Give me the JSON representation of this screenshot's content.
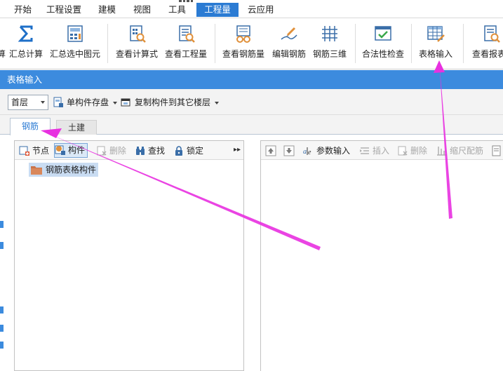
{
  "menu": {
    "items": [
      "开始",
      "工程设置",
      "建模",
      "视图",
      "工具",
      "工程量",
      "云应用"
    ],
    "active_index": 5
  },
  "ribbon": {
    "partial_left_label": "算",
    "buttons": [
      {
        "label": "汇总计算",
        "icon": "sigma-icon"
      },
      {
        "label": "汇总选中图元",
        "icon": "calc-selected-icon"
      },
      {
        "label": "查看计算式",
        "icon": "view-formula-icon"
      },
      {
        "label": "查看工程量",
        "icon": "view-quantity-icon"
      },
      {
        "label": "查看钢筋量",
        "icon": "view-rebar-icon"
      },
      {
        "label": "编辑钢筋",
        "icon": "edit-rebar-icon"
      },
      {
        "label": "钢筋三维",
        "icon": "rebar-3d-icon"
      },
      {
        "label": "合法性检查",
        "icon": "check-icon"
      },
      {
        "label": "表格输入",
        "icon": "table-input-icon"
      },
      {
        "label": "查看报表",
        "icon": "report-icon"
      }
    ]
  },
  "panel": {
    "title": "表格输入"
  },
  "toolbar": {
    "floor_value": "首层",
    "save_component_label": "单构件存盘",
    "copy_component_label": "复制构件到其它楼层"
  },
  "tabs": {
    "rebar_label": "钢筋",
    "civil_label": "土建"
  },
  "left_pane": {
    "node_label": "节点",
    "component_label": "构件",
    "delete_label": "删除",
    "find_label": "查找",
    "lock_label": "锁定",
    "tree_item_label": "钢筋表格构件"
  },
  "right_pane": {
    "param_input_label": "参数输入",
    "insert_label": "插入",
    "delete_label": "删除",
    "scale_rebar_label": "缩尺配筋"
  },
  "colors": {
    "accent": "#2b7bd3",
    "title_bar": "#3c8bde",
    "annotation": "#e830e0"
  }
}
